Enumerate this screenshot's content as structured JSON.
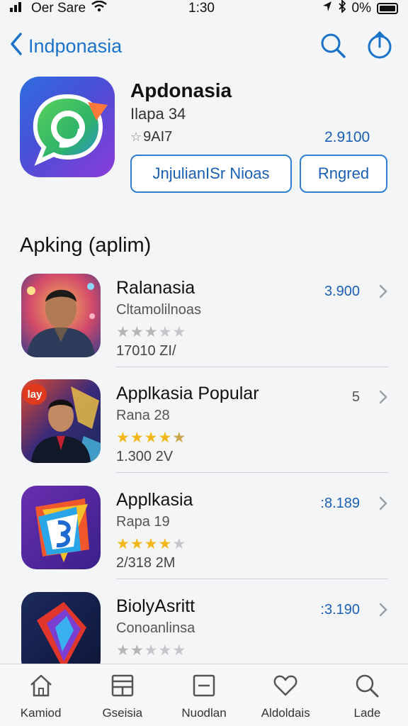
{
  "status": {
    "carrier": "Oer Sare",
    "time": "1:30",
    "battery": "0%"
  },
  "nav": {
    "back_label": "Indponasia"
  },
  "hero": {
    "title": "Apdonasia",
    "subtitle": "Ilapa 34",
    "rating": "9AI7",
    "price": "2.9100",
    "primary_button": "JnjulianISr Nioas",
    "secondary_button": "Rngred"
  },
  "section": {
    "title": "Apking (aplim)"
  },
  "apps": [
    {
      "name": "Ralanasia",
      "subtitle": "Cltamolilnoas",
      "size": "17010 ZI/",
      "price": "3.900",
      "stars": 2.5,
      "star_color": "#b5b5b5"
    },
    {
      "name": "Applkasia Popular",
      "subtitle": "Rana 28",
      "size": "1.300 2V",
      "price": "5",
      "stars": 4.5,
      "star_color": "#f2b81a",
      "badge": "lay"
    },
    {
      "name": "Applkasia",
      "subtitle": "Rapa 19",
      "size": "2/318 2M",
      "price": ":8.189",
      "stars": 4,
      "star_color": "#f2b81a"
    },
    {
      "name": "BiolyAsritt",
      "subtitle": "Conoanlinsa",
      "size": "",
      "price": ":3.190",
      "stars": 2,
      "star_color": "#b5b5b5"
    }
  ],
  "tabs": [
    {
      "label": "Kamiod",
      "icon": "home-icon"
    },
    {
      "label": "Gseisia",
      "icon": "layout-icon"
    },
    {
      "label": "Nuodlan",
      "icon": "square-icon"
    },
    {
      "label": "Aldoldais",
      "icon": "heart-icon"
    },
    {
      "label": "Lade",
      "icon": "search-icon"
    }
  ],
  "colors": {
    "accent": "#1a73c8",
    "star_gold": "#f2b81a",
    "star_gray": "#b5b5b5"
  }
}
